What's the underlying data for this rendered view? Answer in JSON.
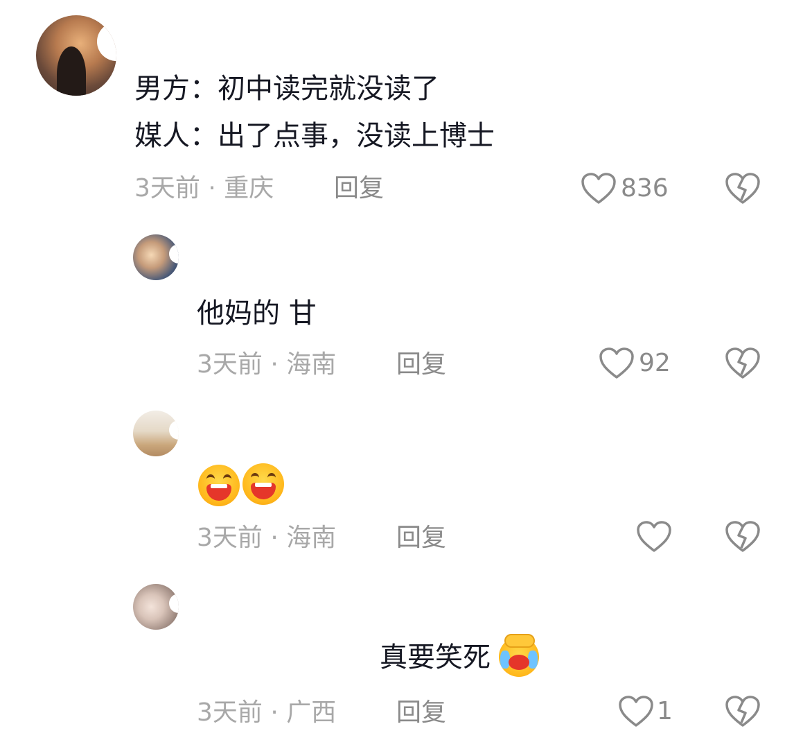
{
  "colors": {
    "text": "#161823",
    "meta": "#a8a8a8",
    "action": "#8a8a8a",
    "background": "#ffffff"
  },
  "comments": [
    {
      "lines": [
        "男方：初中读完就没读了",
        "媒人：出了点事，没读上博士"
      ],
      "meta": "3天前 · 重庆",
      "reply_label": "回复",
      "like_count": "836",
      "icons": [
        "heart-icon",
        "broken-heart-icon"
      ]
    },
    {
      "text": "他妈的 甘",
      "meta": "3天前 · 海南",
      "reply_label": "回复",
      "like_count": "92"
    },
    {
      "emoji": [
        "laughing-emoji",
        "laughing-emoji"
      ],
      "meta": "3天前 · 海南",
      "reply_label": "回复",
      "like_count": ""
    },
    {
      "text": "真要笑死",
      "emoji": "crying-laughing-emoji",
      "meta": "3天前 · 广西",
      "reply_label": "回复",
      "like_count": "1"
    }
  ]
}
